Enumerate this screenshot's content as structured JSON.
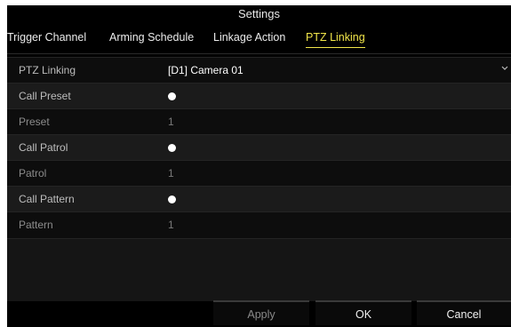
{
  "window": {
    "title": "Settings"
  },
  "tabs": [
    {
      "label": "Trigger Channel"
    },
    {
      "label": "Arming Schedule"
    },
    {
      "label": "Linkage Action"
    },
    {
      "label": "PTZ Linking"
    }
  ],
  "form": {
    "ptz_linking": {
      "label": "PTZ Linking",
      "value": "[D1] Camera 01"
    },
    "call_preset": {
      "label": "Call Preset",
      "checked": true
    },
    "preset": {
      "label": "Preset",
      "value": "1"
    },
    "call_patrol": {
      "label": "Call Patrol",
      "checked": true
    },
    "patrol": {
      "label": "Patrol",
      "value": "1"
    },
    "call_pattern": {
      "label": "Call Pattern",
      "checked": true
    },
    "pattern": {
      "label": "Pattern",
      "value": "1"
    }
  },
  "buttons": {
    "apply": "Apply",
    "ok": "OK",
    "cancel": "Cancel"
  },
  "colors": {
    "active_tab": "#f2e64a",
    "background": "#000000"
  },
  "icons": {
    "dropdown": "chevron-down-icon",
    "radio": "radio-selected-icon"
  }
}
